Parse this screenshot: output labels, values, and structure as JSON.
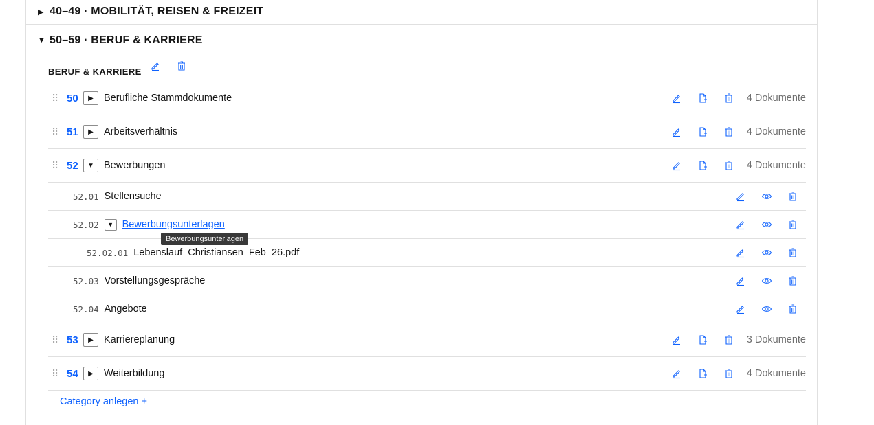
{
  "sections": {
    "collapsed": {
      "title": "40–49 · MOBILITÄT, REISEN & FREIZEIT",
      "caret": "▶"
    },
    "expanded": {
      "title": "50–59 · BERUF & KARRIERE",
      "caret": "▼"
    }
  },
  "group": {
    "title": "BERUF & KARRIERE"
  },
  "rows": [
    {
      "num": "50",
      "toggle": "▶",
      "label": "Berufliche Stammdokumente",
      "count": "4 Dokumente"
    },
    {
      "num": "51",
      "toggle": "▶",
      "label": "Arbeitsverhältnis",
      "count": "4 Dokumente"
    },
    {
      "num": "52",
      "toggle": "▼",
      "label": "Bewerbungen",
      "count": "4 Dokumente"
    },
    {
      "num": "53",
      "toggle": "▶",
      "label": "Karriereplanung",
      "count": "3 Dokumente"
    },
    {
      "num": "54",
      "toggle": "▶",
      "label": "Weiterbildung",
      "count": "4 Dokumente"
    }
  ],
  "subrows": [
    {
      "code": "52.01",
      "label": "Stellensuche"
    },
    {
      "code": "52.02",
      "toggle": "▼",
      "label": "Bewerbungsunterlagen"
    },
    {
      "code": "52.02.01",
      "label": "Lebenslauf_Christiansen_Feb_26.pdf"
    },
    {
      "code": "52.03",
      "label": "Vorstellungsgespräche"
    },
    {
      "code": "52.04",
      "label": "Angebote"
    }
  ],
  "tooltip": "Bewerbungsunterlagen",
  "add_category": "Category anlegen +",
  "drag_glyph": "⠿",
  "colors": {
    "accent": "#0f62fe",
    "border": "#e0e0e0",
    "muted": "#6f6f6f"
  },
  "icons": [
    "pencil-icon",
    "document-add-icon",
    "trash-icon",
    "eye-icon",
    "drag-handle-icon"
  ]
}
